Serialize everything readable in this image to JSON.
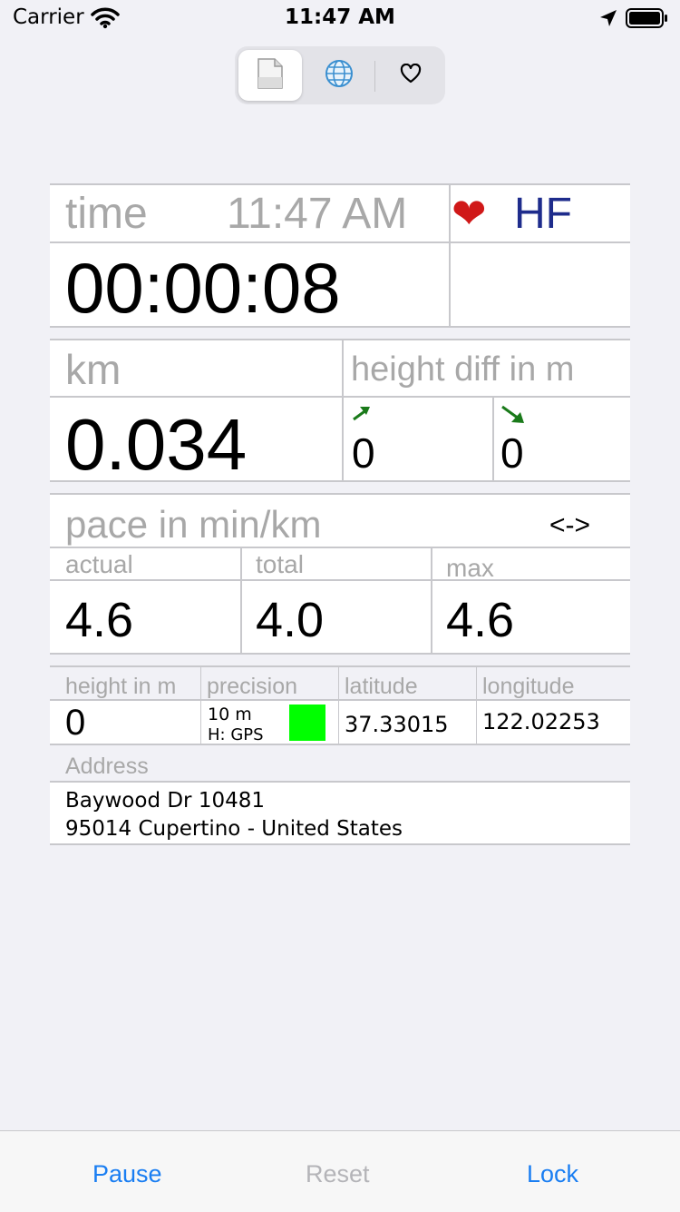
{
  "status_bar": {
    "carrier": "Carrier",
    "time": "11:47 AM"
  },
  "segmented_control": {
    "selected": "document",
    "segments": [
      "document-icon",
      "globe-icon",
      "heart-outline-icon"
    ]
  },
  "time_section": {
    "label": "time",
    "clock": "11:47 AM",
    "elapsed": "00:00:08",
    "heart_symbol": "❤",
    "hf_label": "HF"
  },
  "distance_section": {
    "label": "km",
    "value": "0.034",
    "height_diff_label": "height diff in m",
    "ascent": "0",
    "descent": "0"
  },
  "pace_section": {
    "label": "pace in min/km",
    "toggle": "<->",
    "actual_label": "actual",
    "total_label": "total",
    "max_label": "max",
    "actual": "4.6",
    "total": "4.0",
    "max": "4.6"
  },
  "location_section": {
    "height_label": "height in m",
    "precision_label": "precision",
    "latitude_label": "latitude",
    "longitude_label": "longitude",
    "height": "0",
    "precision_value": "10 m",
    "precision_source": "H: GPS",
    "precision_color": "#00ff00",
    "latitude": "37.33015",
    "longitude": "122.02253",
    "address_label": "Address",
    "address_line1": "Baywood Dr 10481",
    "address_line2": "95014 Cupertino - United States"
  },
  "toolbar": {
    "pause": "Pause",
    "reset": "Reset",
    "lock": "Lock"
  },
  "colors": {
    "accent": "#1a7ef2",
    "disabled": "#b4b4b8",
    "label_gray": "#a8a8a8",
    "hf_blue": "#1e2c8c",
    "arrow_green": "#1a7a1a"
  }
}
